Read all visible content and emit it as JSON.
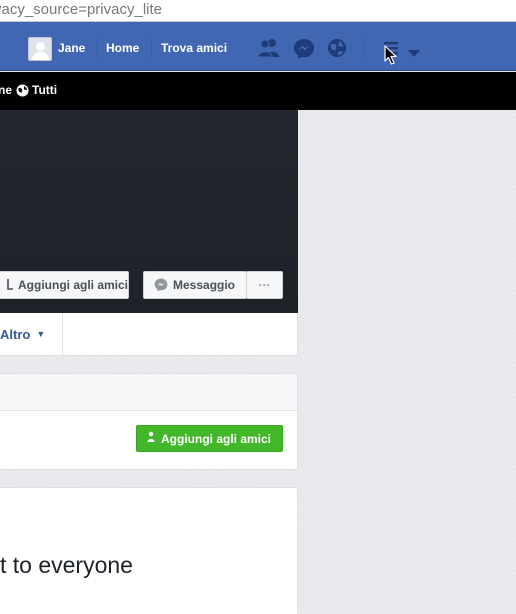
{
  "browser": {
    "url_fragment": "vacy_source=privacy_lite"
  },
  "topbar": {
    "user_name": "Jane",
    "home_label": "Home",
    "find_friends_label": "Trova amici",
    "icons": [
      "friend-requests-icon",
      "messenger-icon",
      "notifications-globe-icon",
      "privacy-shortcuts-icon",
      "account-menu-caret-icon"
    ],
    "brand_color": "#4267b2"
  },
  "privacy_bar": {
    "fragment": "ne",
    "audience_label": "Tutti"
  },
  "profile_actions": {
    "add_friend_label": "Aggiungi agli amici",
    "message_label": "Messaggio",
    "more_label": "···"
  },
  "tabs": {
    "more_label": "Altro"
  },
  "card": {
    "add_friend_button_label": "Aggiungi agli amici",
    "button_color": "#42b72a"
  },
  "post": {
    "text_fragment": "t to everyone"
  }
}
